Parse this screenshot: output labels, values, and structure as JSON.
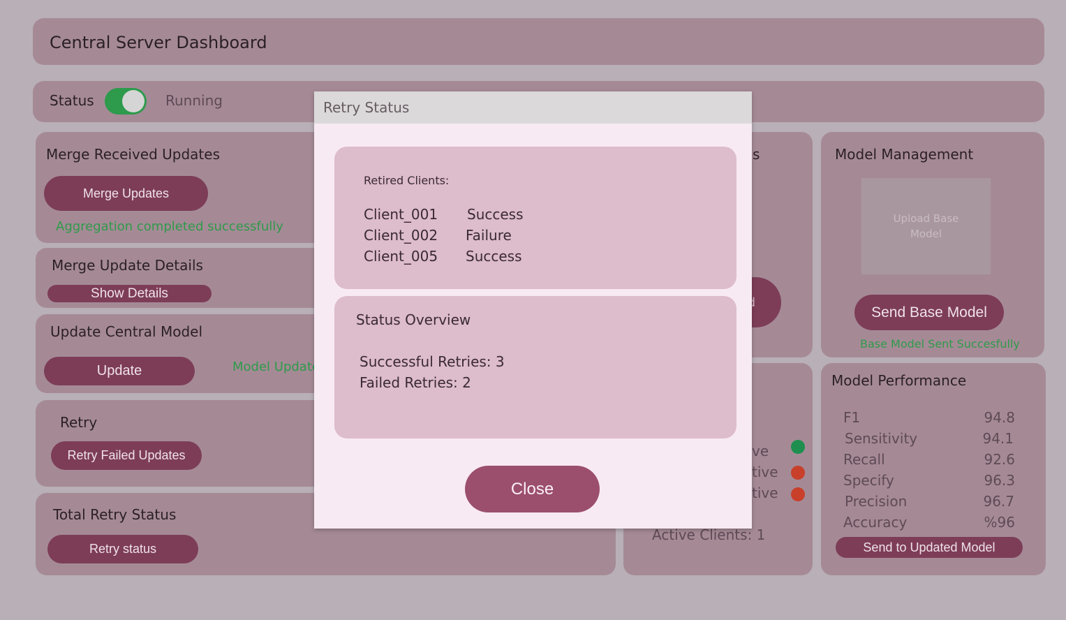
{
  "header": {
    "title": "Central Server Dashboard"
  },
  "status_bar": {
    "label": "Status",
    "toggle_on": true,
    "state_text": "Running"
  },
  "merge_received": {
    "title": "Merge Received Updates",
    "button": "Merge Updates",
    "message": "Aggregation completed successfully"
  },
  "merge_details": {
    "title": "Merge Update Details",
    "button": "Show Details"
  },
  "update_central": {
    "title": "Update Central Model",
    "button": "Update",
    "message": "Model Update"
  },
  "retry": {
    "title": "Retry",
    "button": "Retry Failed Updates"
  },
  "total_retry": {
    "title": "Total Retry Status",
    "button": "Retry status"
  },
  "partial_panel": {
    "title_fragment": "s",
    "button_fragment": "d",
    "client_rows": [
      {
        "text": "ve",
        "color": "#1e8f4e"
      },
      {
        "text": "tive",
        "color": "#c8402a"
      },
      {
        "text": "tive",
        "color": "#c8402a"
      }
    ],
    "active_clients": "Active Clients: 1"
  },
  "model_management": {
    "title": "Model Management",
    "upload_line1": "Upload Base",
    "upload_line2": "Model",
    "button": "Send Base Model",
    "message": "Base Model Sent Succesfully"
  },
  "model_performance": {
    "title": "Model Performance",
    "metrics": [
      {
        "name": "F1",
        "value": "94.8"
      },
      {
        "name": "Sensitivity",
        "value": "94.1"
      },
      {
        "name": "Recall",
        "value": "92.6"
      },
      {
        "name": "Specify",
        "value": "96.3"
      },
      {
        "name": "Precision",
        "value": "96.7"
      },
      {
        "name": "Accuracy",
        "value": "%96"
      }
    ],
    "button": "Send to Updated Model"
  },
  "modal": {
    "title": "Retry Status",
    "retired_label": "Retired Clients:",
    "clients": [
      {
        "id": "Client_001",
        "status": "Success"
      },
      {
        "id": "Client_002",
        "status": "Failure"
      },
      {
        "id": "Client_005",
        "status": "Success"
      }
    ],
    "overview_title": "Status Overview",
    "successful": "Successful Retries: 3",
    "failed": "Failed Retries: 2",
    "close": "Close"
  }
}
